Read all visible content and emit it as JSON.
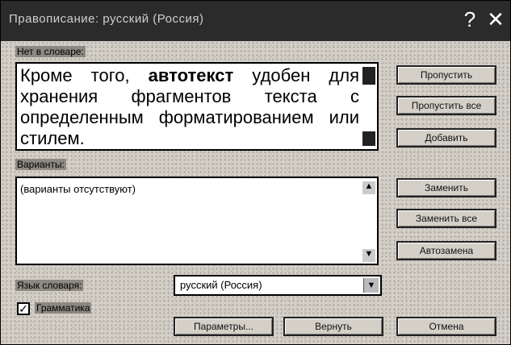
{
  "dialog": {
    "title": "Правописание: русский (Россия)",
    "help_label": "?",
    "close_label": "✕"
  },
  "not_in_dictionary": {
    "label": "Нет в словаре:",
    "text_before": "Кроме того, ",
    "text_bold": "автотекст",
    "text_after": " удобен для хранения фрагментов текста с определенным форматированием или стилем."
  },
  "suggestions": {
    "label": "Варианты:",
    "items": [
      "(варианты отсутствуют)"
    ]
  },
  "dictionary_language": {
    "label": "Язык словаря:",
    "value": "русский (Россия)"
  },
  "grammar_check": {
    "label": "Грамматика",
    "checked": true
  },
  "buttons": {
    "ignore": "Пропустить",
    "ignore_all": "Пропустить все",
    "add": "Добавить",
    "change": "Заменить",
    "change_all": "Заменить все",
    "autocorrect": "Автозамена",
    "options": "Параметры...",
    "undo": "Вернуть",
    "cancel": "Отмена"
  },
  "icons": {
    "dropdown_arrow": "▼",
    "scroll_up": "▲",
    "scroll_down": "▼",
    "checkmark": "✓"
  }
}
